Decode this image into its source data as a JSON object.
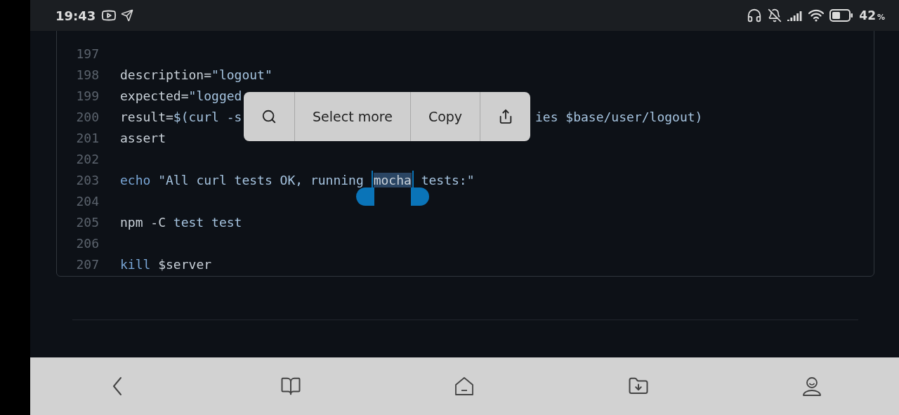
{
  "status_bar": {
    "time": "19:43",
    "battery": "42",
    "battery_unit": "%"
  },
  "code": {
    "lines": [
      {
        "number": "197"
      },
      {
        "number": "198",
        "tokens": [
          {
            "kind": "plain",
            "text": "description="
          },
          {
            "kind": "string",
            "text": "\"logout\""
          }
        ]
      },
      {
        "number": "199",
        "tokens": [
          {
            "kind": "plain",
            "text": "expected="
          },
          {
            "kind": "string",
            "text": "\"logged"
          }
        ]
      },
      {
        "number": "200",
        "tokens": [
          {
            "kind": "plain",
            "text": "result="
          },
          {
            "kind": "string",
            "text": "$(curl -s"
          },
          {
            "kind": "tail",
            "text": "ies $base/user/logout)"
          }
        ]
      },
      {
        "number": "201",
        "tokens": [
          {
            "kind": "plain",
            "text": "assert"
          }
        ]
      },
      {
        "number": "202"
      },
      {
        "number": "203",
        "tokens": [
          {
            "kind": "keyword",
            "text": "echo"
          },
          {
            "kind": "string",
            "text": " \"All curl tests OK, running "
          },
          {
            "kind": "selected",
            "text": "mocha"
          },
          {
            "kind": "string",
            "text": " tests:\""
          }
        ]
      },
      {
        "number": "204"
      },
      {
        "number": "205",
        "tokens": [
          {
            "kind": "plain",
            "text": "npm -C "
          },
          {
            "kind": "string",
            "text": "test test"
          }
        ]
      },
      {
        "number": "206"
      },
      {
        "number": "207",
        "tokens": [
          {
            "kind": "keyword",
            "text": "kill"
          },
          {
            "kind": "plain",
            "text": " $server"
          }
        ]
      }
    ]
  },
  "selection_menu": {
    "items": [
      {
        "kind": "search"
      },
      {
        "kind": "text",
        "label": "Select more"
      },
      {
        "kind": "text",
        "label": "Copy"
      },
      {
        "kind": "share"
      }
    ]
  },
  "bottom_nav": {
    "items": [
      {
        "kind": "back"
      },
      {
        "kind": "book"
      },
      {
        "kind": "home"
      },
      {
        "kind": "downloads"
      },
      {
        "kind": "profile"
      }
    ]
  }
}
